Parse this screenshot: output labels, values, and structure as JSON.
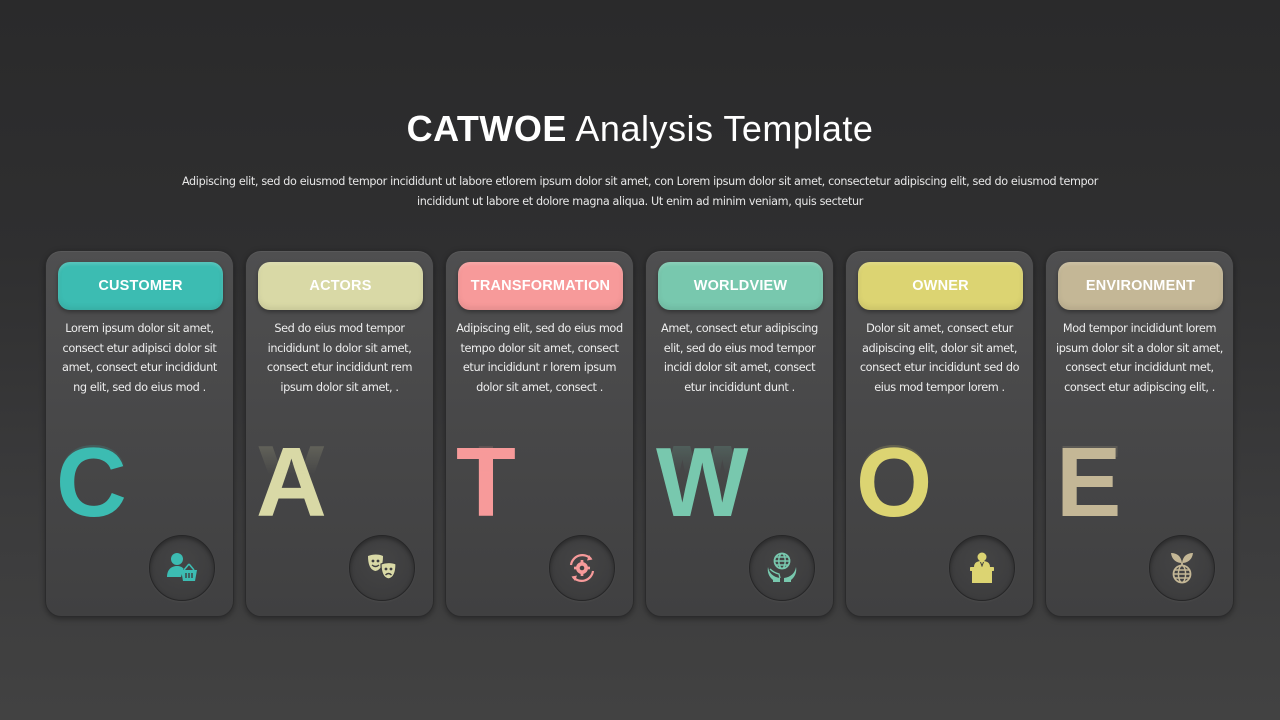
{
  "header": {
    "title_bold": "CATWOE",
    "title_light": "Analysis Template",
    "subtitle_line1": "Adipiscing elit, sed do eiusmod tempor incididunt ut labore etlorem ipsum dolor sit amet, con Lorem ipsum dolor sit amet, consectetur adipiscing elit, sed do eiusmod tempor",
    "subtitle_line2": "incididunt ut labore et dolore magna aliqua. Ut enim ad minim veniam, quis sectetur"
  },
  "cards": [
    {
      "label": "CUSTOMER",
      "letter": "C",
      "color": "#3cbcb2",
      "icon": "customer-basket-icon",
      "lines": [
        "Lorem ipsum dolor sit amet,",
        "consect etur adipisci dolor sit",
        "amet, consect etur incididunt",
        "ng elit, sed do eius mod ."
      ]
    },
    {
      "label": "ACTORS",
      "letter": "A",
      "color": "#d9d9a6",
      "icon": "theater-masks-icon",
      "lines": [
        "Sed do eius mod tempor",
        "incididunt lo dolor sit amet,",
        "consect etur incididunt rem",
        "ipsum dolor sit amet, ."
      ]
    },
    {
      "label": "TRANSFORMATION",
      "letter": "T",
      "color": "#f79a9a",
      "icon": "gear-refresh-icon",
      "lines": [
        "Adipiscing elit, sed do eius mod",
        "tempo dolor sit amet, consect",
        "etur incididunt r lorem ipsum",
        "dolor sit amet, consect ."
      ]
    },
    {
      "label": "WORLDVIEW",
      "letter": "W",
      "color": "#78c8ae",
      "icon": "globe-hands-icon",
      "lines": [
        "Amet, consect etur adipiscing",
        "elit, sed do eius mod tempor",
        "incidi dolor sit amet, consect",
        "etur incididunt dunt ."
      ]
    },
    {
      "label": "OWNER",
      "letter": "O",
      "color": "#dcd472",
      "icon": "speaker-podium-icon",
      "lines": [
        "Dolor sit amet, consect etur",
        "adipiscing elit, dolor sit amet,",
        "consect etur incididunt sed do",
        "eius mod tempor lorem ."
      ]
    },
    {
      "label": "ENVIRONMENT",
      "letter": "E",
      "color": "#c4b796",
      "icon": "globe-sprout-icon",
      "lines": [
        "Mod tempor incididunt lorem",
        "ipsum dolor sit a dolor sit amet,",
        "consect etur incididunt met,",
        "consect etur adipiscing elit, ."
      ]
    }
  ]
}
